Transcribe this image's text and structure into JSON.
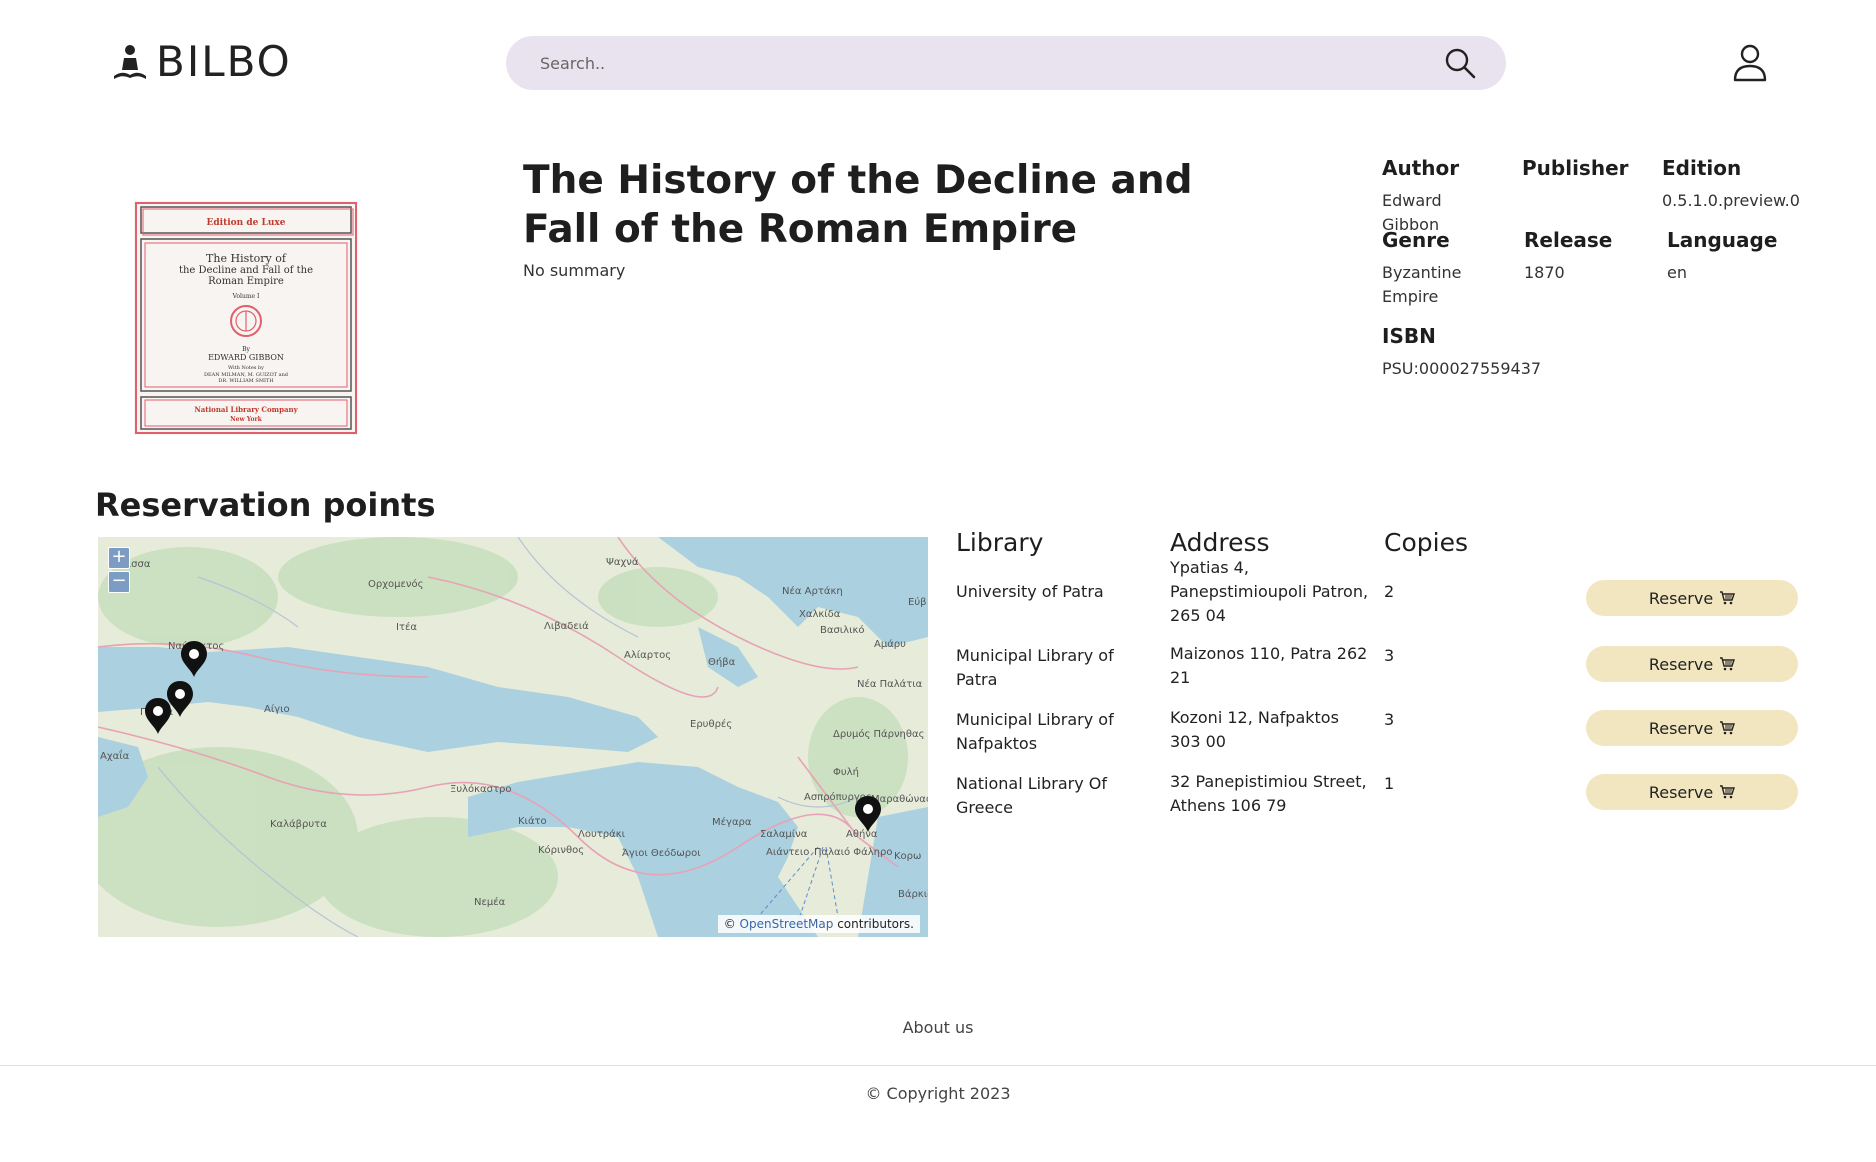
{
  "header": {
    "brand": "BILBO",
    "search_placeholder": "Search..",
    "search_icon": "search-icon",
    "user_icon": "user-icon"
  },
  "book": {
    "title": "The History of the Decline and Fall of the Roman Empire",
    "summary": "No summary",
    "cover": {
      "top_banner": "Edition de Luxe",
      "title_line1": "The History of",
      "title_line2": "the Decline and Fall of the",
      "title_line3": "Roman Empire",
      "volume": "Volume I",
      "by": "By",
      "author": "EDWARD GIBBON",
      "notes_line1": "With Notes by",
      "notes_line2": "DEAN MILMAN, M. GUIZOT and",
      "notes_line3": "DR. WILLIAM SMITH",
      "publisher_line1": "National Library Company",
      "publisher_line2": "New York"
    },
    "meta": {
      "author_label": "Author",
      "author": "Edward Gibbon",
      "publisher_label": "Publisher",
      "publisher": "",
      "edition_label": "Edition",
      "edition": "0.5.1.0.preview.0",
      "genre_label": "Genre",
      "genre": "Byzantine Empire",
      "release_label": "Release",
      "release": "1870",
      "language_label": "Language",
      "language": "en",
      "isbn_label": "ISBN",
      "isbn": "PSU:000027559437"
    }
  },
  "reservation": {
    "title": "Reservation points",
    "map": {
      "zoom_in": "+",
      "zoom_out": "−",
      "attribution_prefix": "©",
      "attribution_link": "OpenStreetMap",
      "attribution_suffix": "contributors.",
      "places": [
        "Αμφισσα",
        "Ορχομενός",
        "Ψαχνά",
        "Νέα Αρτάκη",
        "Εύβ",
        "Ιτέα",
        "Λιβαδειά",
        "Χαλκίδα",
        "Βασιλικό",
        "Αμάρυ",
        "Ναύπακτος",
        "Αλίαρτος",
        "Θήβα",
        "Νέα Παλάτια",
        "Αίγιο",
        "Ερυθρές",
        "Αχαΐα",
        "Δρυμός Πάρνηθας",
        "Φυλή",
        "Ξυλόκαστρο",
        "Ασπρόπυργος",
        "Μαραθώνας",
        "Καλάβρυτα",
        "Κιάτο",
        "Λουτράκι",
        "Μέγαρα",
        "Αθήνα",
        "Κόρινθος",
        "Άγιοι Θεόδωροι",
        "Σαλαμίνα",
        "Αιάντειο",
        "Παλαιό Φάληρο",
        "Κορω",
        "Βάρκιζα",
        "Νεμέα",
        "Πάτρα"
      ]
    },
    "columns": [
      "Library",
      "Address",
      "Copies"
    ],
    "reserve_label": "Reserve",
    "cart_icon": "cart-icon",
    "libraries": [
      {
        "name": "University of Patra",
        "address": "Ypatias 4, Panepstimioupoli Patron, 265 04",
        "copies": "2"
      },
      {
        "name": "Municipal Library of Patra",
        "address": "Maizonos 110, Patra 262 21",
        "copies": "3"
      },
      {
        "name": "Municipal Library of Nafpaktos",
        "address": "Kozoni 12, Nafpaktos 303 00",
        "copies": "3"
      },
      {
        "name": "National Library Of Greece",
        "address": "32 Panepistimiou Street, Athens 106 79",
        "copies": "1"
      }
    ]
  },
  "footer": {
    "about": "About us",
    "copyright": "© Copyright 2023"
  }
}
